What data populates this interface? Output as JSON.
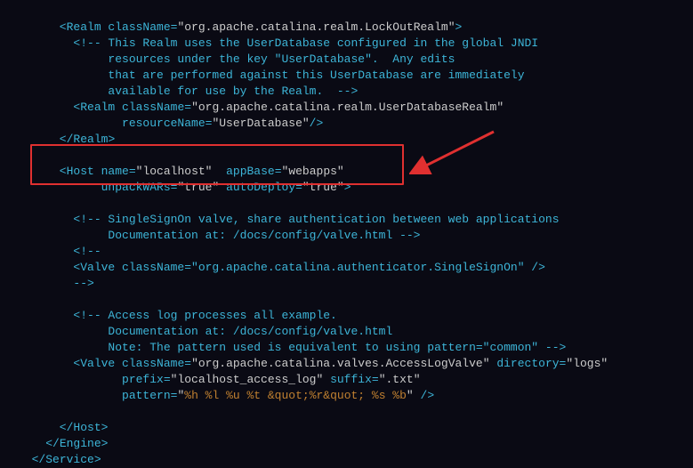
{
  "code": {
    "l0a": "      <",
    "l0b": "Realm",
    "l0c": " className",
    "l0d": "=",
    "l0e": "\"org.apache.catalina.realm.LockOutRealm\"",
    "l0f": ">",
    "l1": "        <!-- This Realm uses the UserDatabase configured in the global JNDI",
    "l2": "             resources under the key \"UserDatabase\".  Any edits",
    "l3": "             that are performed against this UserDatabase are immediately",
    "l4": "             available for use by the Realm.  -->",
    "l5a": "        <",
    "l5b": "Realm",
    "l5c": " className",
    "l5d": "=",
    "l5e": "\"org.apache.catalina.realm.UserDatabaseRealm\"",
    "l6a": "               resourceName",
    "l6b": "=",
    "l6c": "\"UserDatabase\"",
    "l6d": "/>",
    "l7a": "      </",
    "l7b": "Realm",
    "l7c": ">",
    "l8": "",
    "l9a": "      <",
    "l9b": "Host",
    "l9c": " name",
    "l9d": "=",
    "l9e": "\"localhost\"",
    "l9f": "  appBase",
    "l9g": "=",
    "l9h": "\"webapps\"",
    "l10a": "            unpackWARs",
    "l10b": "=",
    "l10c": "\"true\"",
    "l10d": " autoDeploy",
    "l10e": "=",
    "l10f": "\"true\"",
    "l10g": ">",
    "l11": "",
    "l12": "        <!-- SingleSignOn valve, share authentication between web applications",
    "l13": "             Documentation at: /docs/config/valve.html -->",
    "l14": "        <!--",
    "l15": "        <Valve className=\"org.apache.catalina.authenticator.SingleSignOn\" />",
    "l16": "        -->",
    "l17": "",
    "l18": "        <!-- Access log processes all example.",
    "l19": "             Documentation at: /docs/config/valve.html",
    "l20": "             Note: The pattern used is equivalent to using pattern=\"common\" -->",
    "l21a": "        <",
    "l21b": "Valve",
    "l21c": " className",
    "l21d": "=",
    "l21e": "\"org.apache.catalina.valves.AccessLogValve\"",
    "l21f": " directory",
    "l21g": "=",
    "l21h": "\"logs\"",
    "l22a": "               prefix",
    "l22b": "=",
    "l22c": "\"localhost_access_log\"",
    "l22d": " suffix",
    "l22e": "=",
    "l22f": "\".txt\"",
    "l23a": "               pattern",
    "l23b": "=",
    "l23c": "\"",
    "l23d": "%h %l %u %t &quot;%r&quot; %s %b",
    "l23e": "\"",
    "l23f": " />",
    "l24": "",
    "l25a": "      </",
    "l25b": "Host",
    "l25c": ">",
    "l26a": "    </",
    "l26b": "Engine",
    "l26c": ">",
    "l27a": "  </",
    "l27b": "Service",
    "l27c": ">"
  },
  "colors": {
    "highlight_border": "#e03030",
    "arrow": "#e03030",
    "tag": "#3db5d8",
    "comment": "#3db5d8",
    "string": "#cccccc",
    "pattern": "#c08030",
    "background": "#0a0a14"
  }
}
